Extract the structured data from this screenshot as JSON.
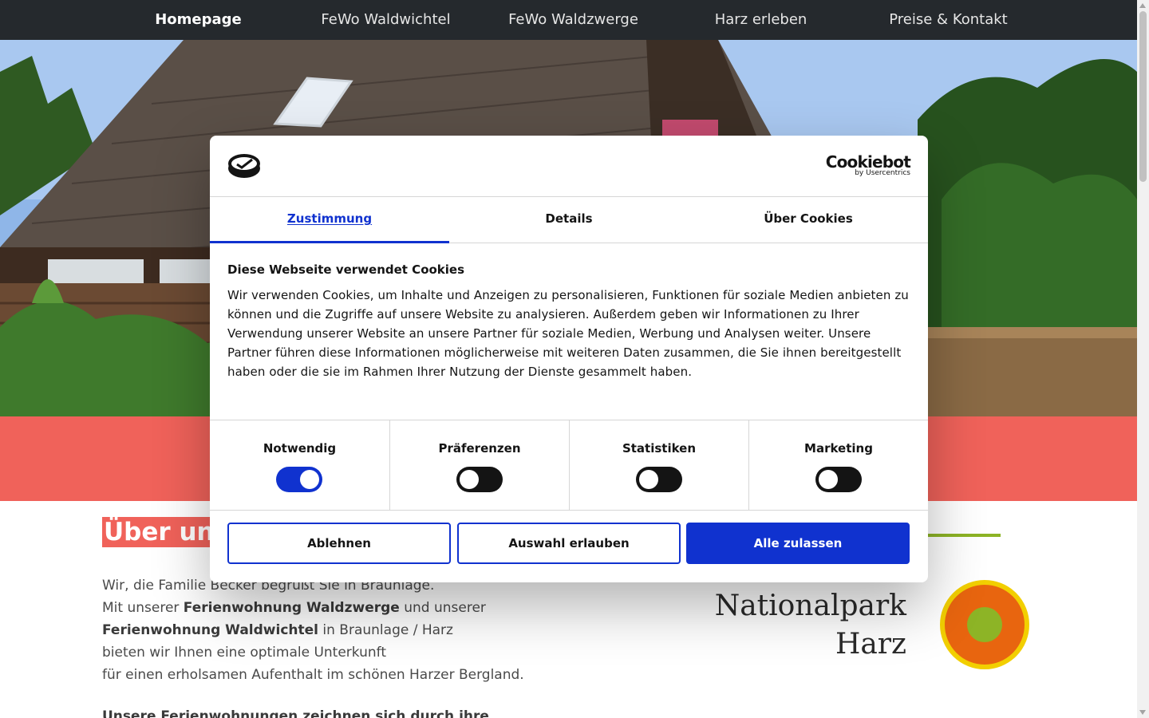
{
  "nav": {
    "items": [
      {
        "label": "Homepage",
        "active": true
      },
      {
        "label": "FeWo Waldwichtel",
        "active": false
      },
      {
        "label": "FeWo Waldzwerge",
        "active": false
      },
      {
        "label": "Harz erleben",
        "active": false
      },
      {
        "label": "Preise & Kontakt",
        "active": false
      }
    ]
  },
  "page": {
    "heading": "Über uns",
    "intro": {
      "line1": "Wir, die Familie Becker begrüßt Sie in Braunlage.",
      "line2_pre": "Mit unserer ",
      "line2_bold": "Ferienwohnung Waldzwerge",
      "line2_post": " und unserer",
      "line3_bold": "Ferienwohnung Waldwichtel",
      "line3_post": " in Braunlage / Harz",
      "line4": "bieten wir Ihnen eine optimale Unterkunft",
      "line5": "für einen erholsamen Aufenthalt im schönen Harzer Bergland.",
      "more": "Unsere Ferienwohnungen zeichnen sich durch ihre"
    },
    "np_logo": {
      "line1": "Nationalpark",
      "line2": "Harz"
    }
  },
  "cookie_dialog": {
    "provider": {
      "name": "Cookiebot",
      "by": "by Usercentrics"
    },
    "tabs": [
      {
        "label": "Zustimmung",
        "active": true
      },
      {
        "label": "Details",
        "active": false
      },
      {
        "label": "Über Cookies",
        "active": false
      }
    ],
    "title": "Diese Webseite verwendet Cookies",
    "text": "Wir verwenden Cookies, um Inhalte und Anzeigen zu personalisieren, Funktionen für soziale Medien anbieten zu können und die Zugriffe auf unsere Website zu analysieren. Außerdem geben wir Informationen zu Ihrer Verwendung unserer Website an unsere Partner für soziale Medien, Werbung und Analysen weiter. Unsere Partner führen diese Informationen möglicherweise mit weiteren Daten zusammen, die Sie ihnen bereitgestellt haben oder die sie im Rahmen Ihrer Nutzung der Dienste gesammelt haben.",
    "categories": [
      {
        "label": "Notwendig",
        "enabled": true
      },
      {
        "label": "Präferenzen",
        "enabled": false
      },
      {
        "label": "Statistiken",
        "enabled": false
      },
      {
        "label": "Marketing",
        "enabled": false
      }
    ],
    "buttons": {
      "reject": "Ablehnen",
      "allow_selection": "Auswahl erlauben",
      "allow_all": "Alle zulassen"
    }
  },
  "colors": {
    "nav_bg": "#25292d",
    "accent_red": "#f0625a",
    "cookiebot_blue": "#1032cf",
    "np_green": "#8db426",
    "np_orange": "#e8650f",
    "np_yellow": "#f2cf00"
  }
}
